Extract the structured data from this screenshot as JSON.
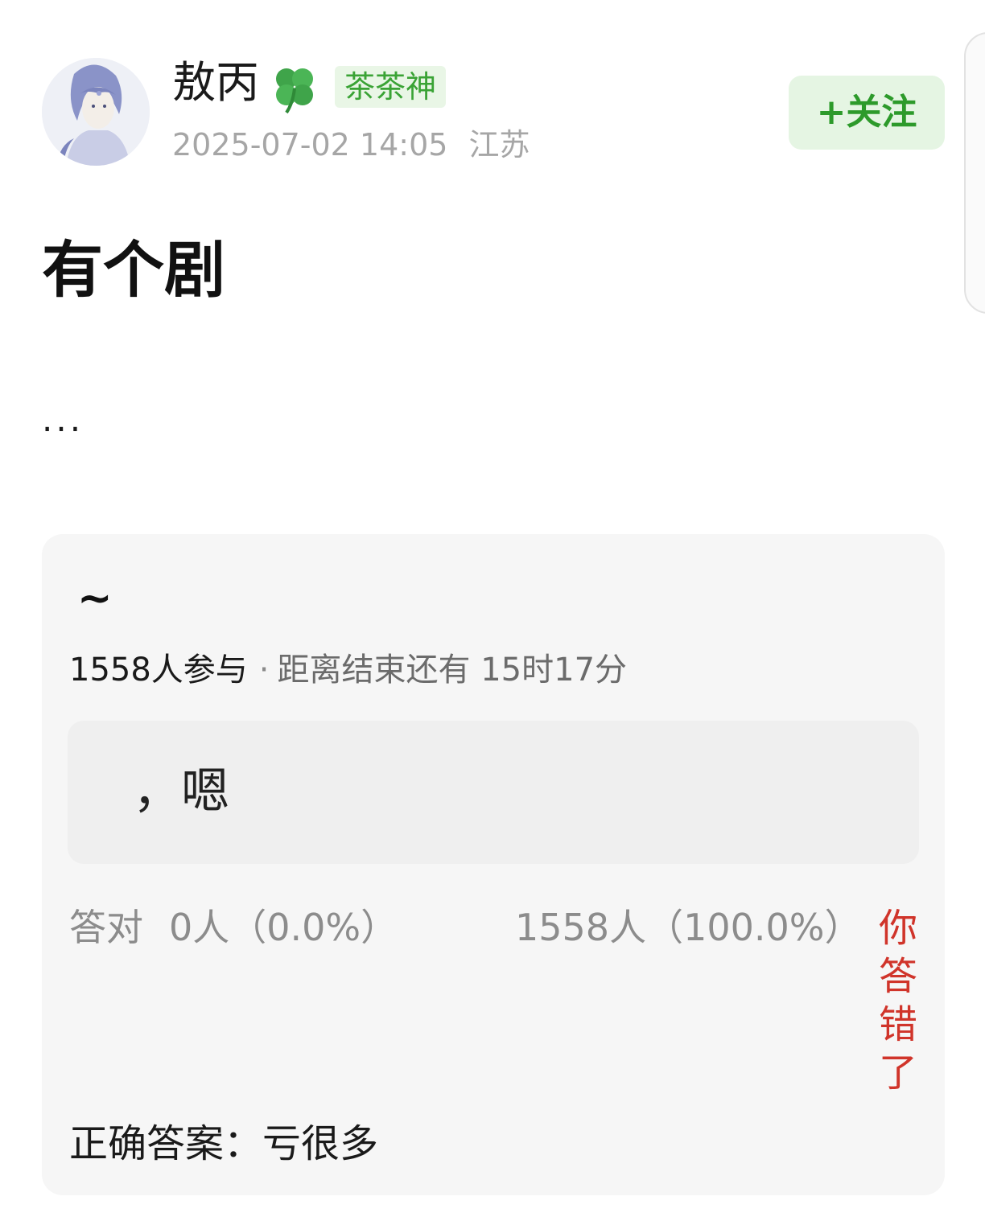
{
  "author": {
    "name": "敖丙",
    "badge": "茶茶神",
    "timestamp": "2025-07-02 14:05",
    "location": "江苏",
    "avatar_icon": "anime-character-avatar",
    "emoji_icon": "four-leaf-clover-icon"
  },
  "follow_button": {
    "label": "+关注"
  },
  "post": {
    "title": "有个剧",
    "ellipsis": "···"
  },
  "quiz": {
    "question": "~",
    "participants": "1558人参与",
    "separator": "·",
    "remaining": "距离结束还有 15时17分",
    "answer_text": " ，嗯",
    "correct_label": "答对",
    "correct_count": "0人（0.0%）",
    "wrong_count": "1558人（100.0%）",
    "result": "你答错了",
    "correct_answer": "正确答案：亏很多"
  },
  "colors": {
    "badge_text": "#3aa335",
    "follow_text": "#2d9a2b",
    "result_red": "#d0342a",
    "card_bg": "#f6f6f6"
  }
}
